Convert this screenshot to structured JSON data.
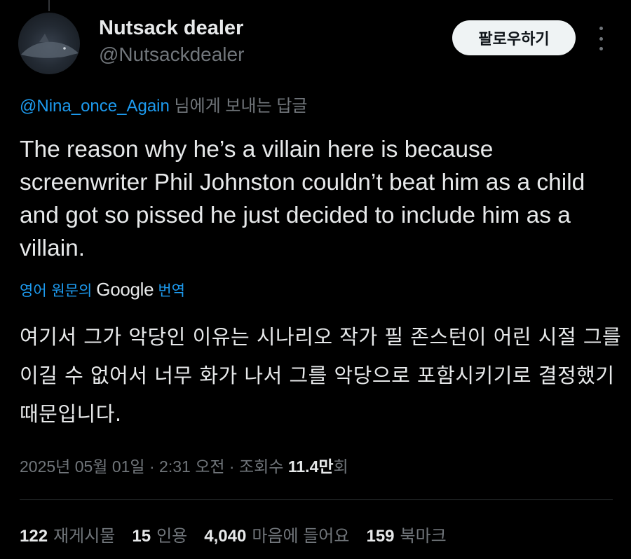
{
  "author": {
    "name": "Nutsack dealer",
    "handle": "@Nutsackdealer"
  },
  "follow_button_label": "팔로우하기",
  "icons": {
    "avatar": "shark-avatar",
    "more": "more-vertical-icon"
  },
  "reply_context": {
    "mention": "@Nina_once_Again",
    "suffix": " 님에게 보내는 답글"
  },
  "tweet_text": "The reason why he’s a villain here is because screenwriter Phil Johnston couldn’t beat him as a child and got so pissed he just decided to include him as a villain.",
  "translation": {
    "prefix": "영어 원문의",
    "provider": "Google",
    "action": "번역",
    "text": "여기서 그가 악당인 이유는 시나리오 작가 필 존스턴이 어린 시절 그를 이길 수 없어서 너무 화가 나서 그를 악당으로 포함시키기로 결정했기 때문입니다."
  },
  "meta": {
    "date": "2025년 05월 01일",
    "sep1": " · ",
    "time": "2:31 오전",
    "sep2": " · ",
    "views_label": "조회수 ",
    "views_count": "11.4만",
    "views_suffix": "회"
  },
  "stats": [
    {
      "count": "122",
      "label": "재게시물"
    },
    {
      "count": "15",
      "label": "인용"
    },
    {
      "count": "4,040",
      "label": "마음에 들어요"
    },
    {
      "count": "159",
      "label": "북마크"
    }
  ],
  "colors": {
    "background": "#000000",
    "text_primary": "#e7e9ea",
    "text_secondary": "#71767b",
    "accent": "#1d9bf0",
    "follow_button_bg": "#eff3f4"
  }
}
